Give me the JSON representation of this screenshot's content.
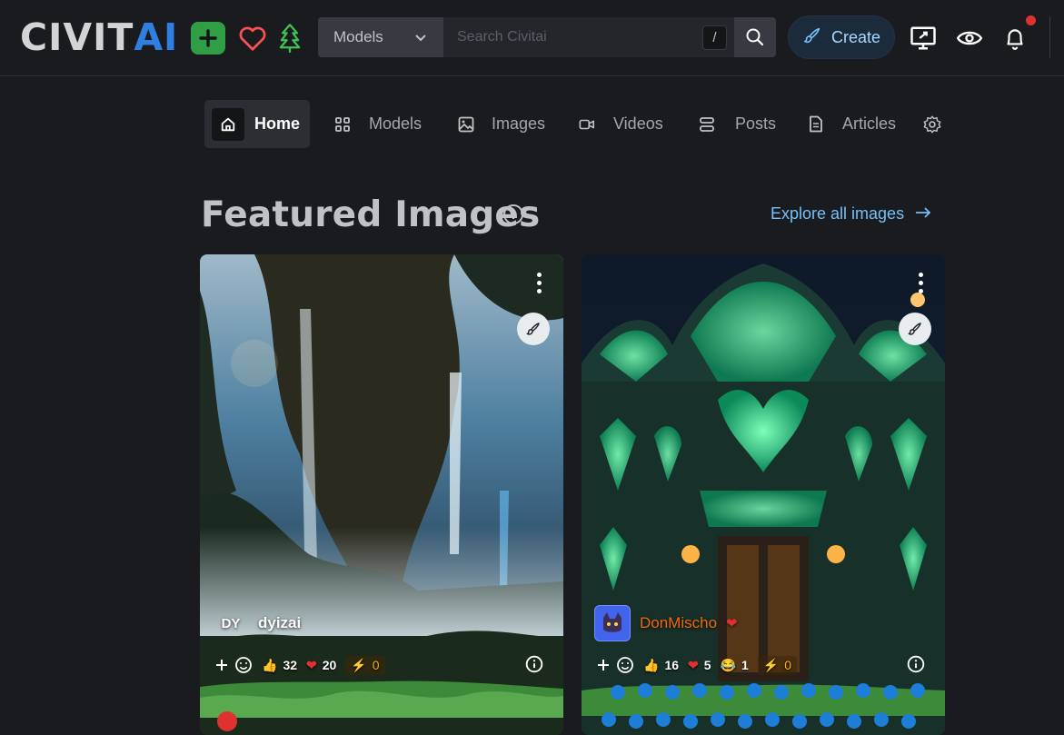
{
  "header": {
    "logo_part1": "CIVIT",
    "logo_part2": "AI",
    "icons": [
      "plus-icon",
      "heart-icon",
      "tree-icon"
    ],
    "search": {
      "category": "Models",
      "placeholder": "Search Civitai",
      "shortcut": "/"
    },
    "create_label": "Create",
    "right_icons": [
      "monitor-icon",
      "eye-icon",
      "bell-icon"
    ]
  },
  "nav": {
    "items": [
      {
        "label": "Home",
        "icon": "home-icon"
      },
      {
        "label": "Models",
        "icon": "grid-icon"
      },
      {
        "label": "Images",
        "icon": "image-icon"
      },
      {
        "label": "Videos",
        "icon": "video-icon"
      },
      {
        "label": "Posts",
        "icon": "posts-icon"
      },
      {
        "label": "Articles",
        "icon": "file-icon"
      }
    ],
    "settings_icon": "gear-icon"
  },
  "featured": {
    "title": "Featured Images",
    "explore_label": "Explore all images"
  },
  "cards": [
    {
      "user_initials": "DY",
      "username": "dyizai",
      "reactions": {
        "like": "32",
        "heart": "20",
        "buzz": "0"
      }
    },
    {
      "username": "DonMischo",
      "reactions": {
        "like": "16",
        "heart": "5",
        "laugh": "1",
        "buzz": "0"
      }
    }
  ],
  "colors": {
    "background": "#1a1b1e",
    "accent": "#74c0fc",
    "brand_blue": "#2f7fe0",
    "green": "#2f9e44",
    "notification": "#e03131"
  }
}
